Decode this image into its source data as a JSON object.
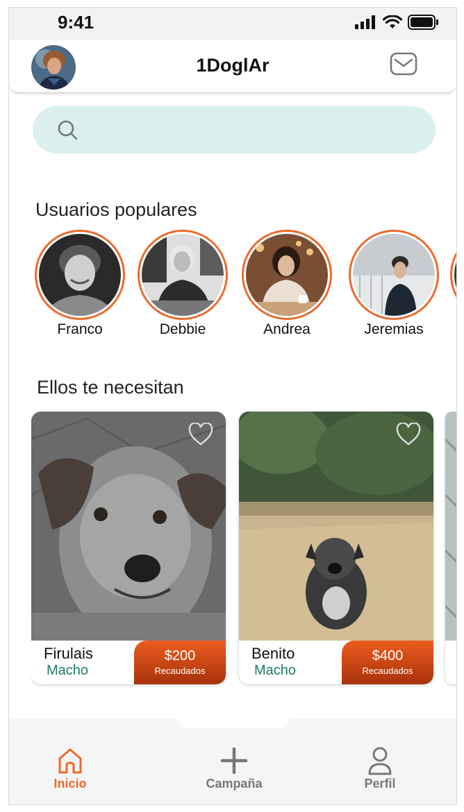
{
  "status_bar": {
    "time": "9:41"
  },
  "header": {
    "title": "1DoglAr",
    "avatar_icon": "avatar",
    "mail_icon": "mail-icon"
  },
  "search": {
    "placeholder": "",
    "value": ""
  },
  "popular_users": {
    "title": "Usuarios populares",
    "items": [
      {
        "name": "Franco"
      },
      {
        "name": "Debbie"
      },
      {
        "name": "Andrea"
      },
      {
        "name": "Jeremias"
      }
    ]
  },
  "pets": {
    "title": "Ellos te necesitan",
    "items": [
      {
        "name": "Firulais",
        "sex": "Macho",
        "amount": "$200",
        "amount_label": "Recaudados"
      },
      {
        "name": "Benito",
        "sex": "Macho",
        "amount": "$400",
        "amount_label": "Recaudados"
      }
    ]
  },
  "nav": {
    "items": [
      {
        "label": "Inicio",
        "icon": "home-icon",
        "active": true
      },
      {
        "label": "Campaña",
        "icon": "plus-icon",
        "active": false
      },
      {
        "label": "Perfil",
        "icon": "person-icon",
        "active": false
      }
    ]
  },
  "colors": {
    "accent": "#ec6a2c",
    "search_bg": "#dbefef",
    "sex_text": "#1f7a6a",
    "nav_inactive": "#777777"
  }
}
